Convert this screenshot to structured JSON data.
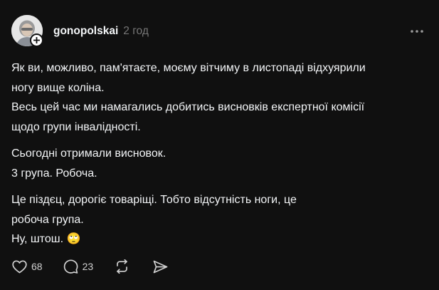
{
  "post": {
    "username": "gonopolskai",
    "time": "2 год",
    "paragraphs": [
      [
        "Як ви, можливо, пам'ятаєте, моєму вітчиму в листопаді відхуярили",
        "ногу вище коліна.",
        "Весь цей час ми намагались добитись висновків експертної комісії",
        "щодо групи інвалідності."
      ],
      [
        "Сьогодні отримали висновок.",
        "3 група. Робоча."
      ],
      [
        "Це піздєц, дорогіє товаріщі. Тобто відсутність ноги, це",
        "робоча група.",
        "Ну, штош. 🙄"
      ]
    ],
    "actions": {
      "likes": "68",
      "replies": "23"
    }
  },
  "icons": {
    "avatar": "avatar",
    "follow": "plus-icon",
    "more": "more-horizontal-icon",
    "like": "heart-icon",
    "reply": "comment-icon",
    "repost": "repost-icon",
    "share": "send-icon"
  },
  "colors": {
    "background": "#101010",
    "text": "#f3f5f7",
    "secondary": "#777777",
    "icon": "#d0d0d0"
  }
}
